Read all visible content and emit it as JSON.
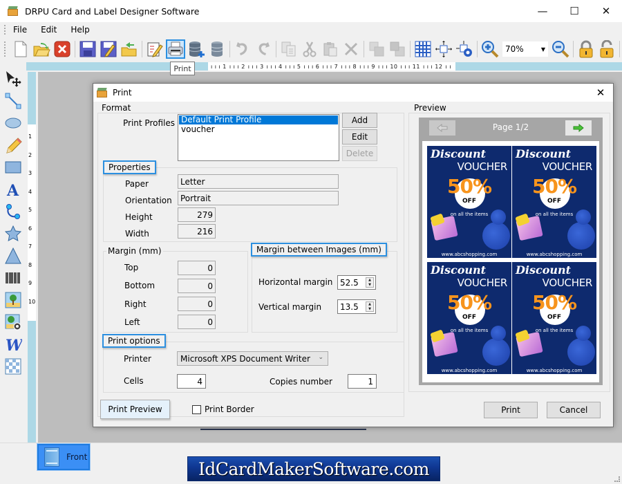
{
  "app": {
    "title": "DRPU Card and Label Designer Software",
    "window_controls": {
      "minimize": "—",
      "maximize": "☐",
      "close": "✕"
    }
  },
  "menu": [
    "File",
    "Edit",
    "Help"
  ],
  "toolbar": {
    "items": [
      "new-icon",
      "open-icon",
      "close-icon",
      "save-icon",
      "save-as-icon",
      "export-icon",
      "edit-icon",
      "print-icon",
      "database-add-icon",
      "database-icon",
      "undo-icon",
      "redo-icon",
      "copy-icon",
      "cut-icon",
      "paste-icon",
      "delete-icon",
      "bring-front-icon",
      "send-back-icon",
      "grid-icon",
      "center-icon",
      "fit-icon",
      "zoom-in-icon",
      "zoom-out-icon",
      "lock-icon",
      "unlock-icon"
    ],
    "active": "print-icon",
    "zoom_value": "70%",
    "tooltip": "Print"
  },
  "ruler": {
    "h_ticks": [
      "1",
      "2",
      "3",
      "4",
      "5",
      "6",
      "7",
      "8",
      "9",
      "10",
      "11",
      "12"
    ],
    "v_ticks": [
      "1",
      "2",
      "3",
      "4",
      "5",
      "6",
      "7",
      "8",
      "9",
      "10"
    ]
  },
  "left_tools": [
    "select-icon",
    "line-icon",
    "ellipse-icon",
    "pencil-icon",
    "rectangle-icon",
    "text-icon",
    "arc-icon",
    "star-icon",
    "triangle-icon",
    "barcode-icon",
    "image-icon",
    "image-library-icon",
    "wordart-icon",
    "watermark-icon"
  ],
  "bottom": {
    "front_tab": "Front",
    "brand": "IdCardMakerSoftware.com"
  },
  "dialog": {
    "title": "Print",
    "format": {
      "label": "Format",
      "profiles_label": "Print Profiles",
      "profiles": [
        "Default Print Profile",
        "voucher"
      ],
      "selected_profile": "Default Print Profile",
      "add": "Add",
      "edit": "Edit",
      "delete": "Delete"
    },
    "properties": {
      "label": "Properties",
      "paper_label": "Paper",
      "paper": "Letter",
      "orientation_label": "Orientation",
      "orientation": "Portrait",
      "height_label": "Height",
      "height": "279",
      "width_label": "Width",
      "width": "216"
    },
    "margin": {
      "label": "Margin (mm)",
      "top_label": "Top",
      "top": "0",
      "bottom_label": "Bottom",
      "bottom": "0",
      "right_label": "Right",
      "right": "0",
      "left_label": "Left",
      "left": "0"
    },
    "margin_images": {
      "label": "Margin between Images (mm)",
      "horizontal_label": "Horizontal margin",
      "horizontal": "52.5",
      "vertical_label": "Vertical margin",
      "vertical": "13.5"
    },
    "print_options": {
      "label": "Print options",
      "printer_label": "Printer",
      "printer": "Microsoft XPS Document Writer",
      "cells_label": "Cells",
      "cells": "4",
      "copies_label": "Copies number",
      "copies": "1"
    },
    "print_preview": "Print Preview",
    "print_border": "Print Border",
    "print_border_checked": false,
    "print": "Print",
    "cancel": "Cancel",
    "preview": {
      "label": "Preview",
      "page": "Page 1/2",
      "voucher": {
        "title": "Discount",
        "subtitle": "VOUCHER",
        "percent": "50%",
        "off": "OFF",
        "tagline": "on all the items",
        "url": "www.abcshopping.com"
      }
    }
  }
}
